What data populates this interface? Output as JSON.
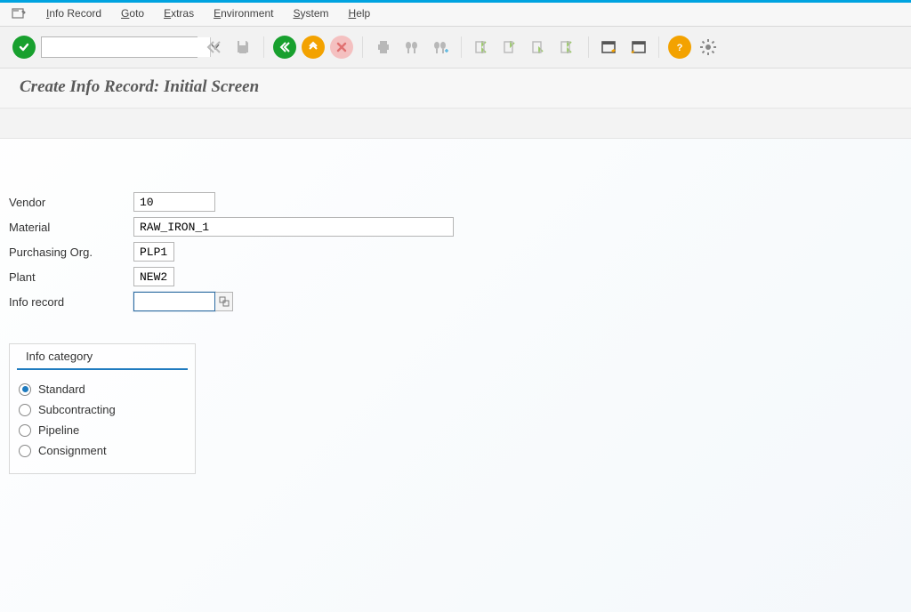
{
  "menu": {
    "info_record": "Info Record",
    "goto": "Goto",
    "extras": "Extras",
    "environment": "Environment",
    "system": "System",
    "help": "Help"
  },
  "toolbar": {
    "tx_value": "",
    "icons": {
      "enter": "enter-icon",
      "back": "back-icon",
      "save": "save-icon",
      "exit": "exit-icon",
      "up": "up-icon",
      "cancel": "cancel-icon",
      "print": "print-icon",
      "find": "find-icon",
      "find_next": "find-next-icon",
      "first": "first-page-icon",
      "prev": "prev-page-icon",
      "next": "next-page-icon",
      "last": "last-page-icon",
      "new_session": "new-session-icon",
      "shortcut": "shortcut-icon",
      "help": "help-icon",
      "settings": "settings-icon"
    }
  },
  "title": "Create Info Record: Initial Screen",
  "fields": {
    "vendor_label": "Vendor",
    "vendor_value": "10",
    "material_label": "Material",
    "material_value": "RAW_IRON_1",
    "porg_label": "Purchasing Org.",
    "porg_value": "PLP1",
    "plant_label": "Plant",
    "plant_value": "NEW2",
    "inforec_label": "Info record",
    "inforec_value": ""
  },
  "group": {
    "legend": "Info category",
    "options": [
      {
        "label": "Standard",
        "checked": true
      },
      {
        "label": "Subcontracting",
        "checked": false
      },
      {
        "label": "Pipeline",
        "checked": false
      },
      {
        "label": "Consignment",
        "checked": false
      }
    ]
  }
}
